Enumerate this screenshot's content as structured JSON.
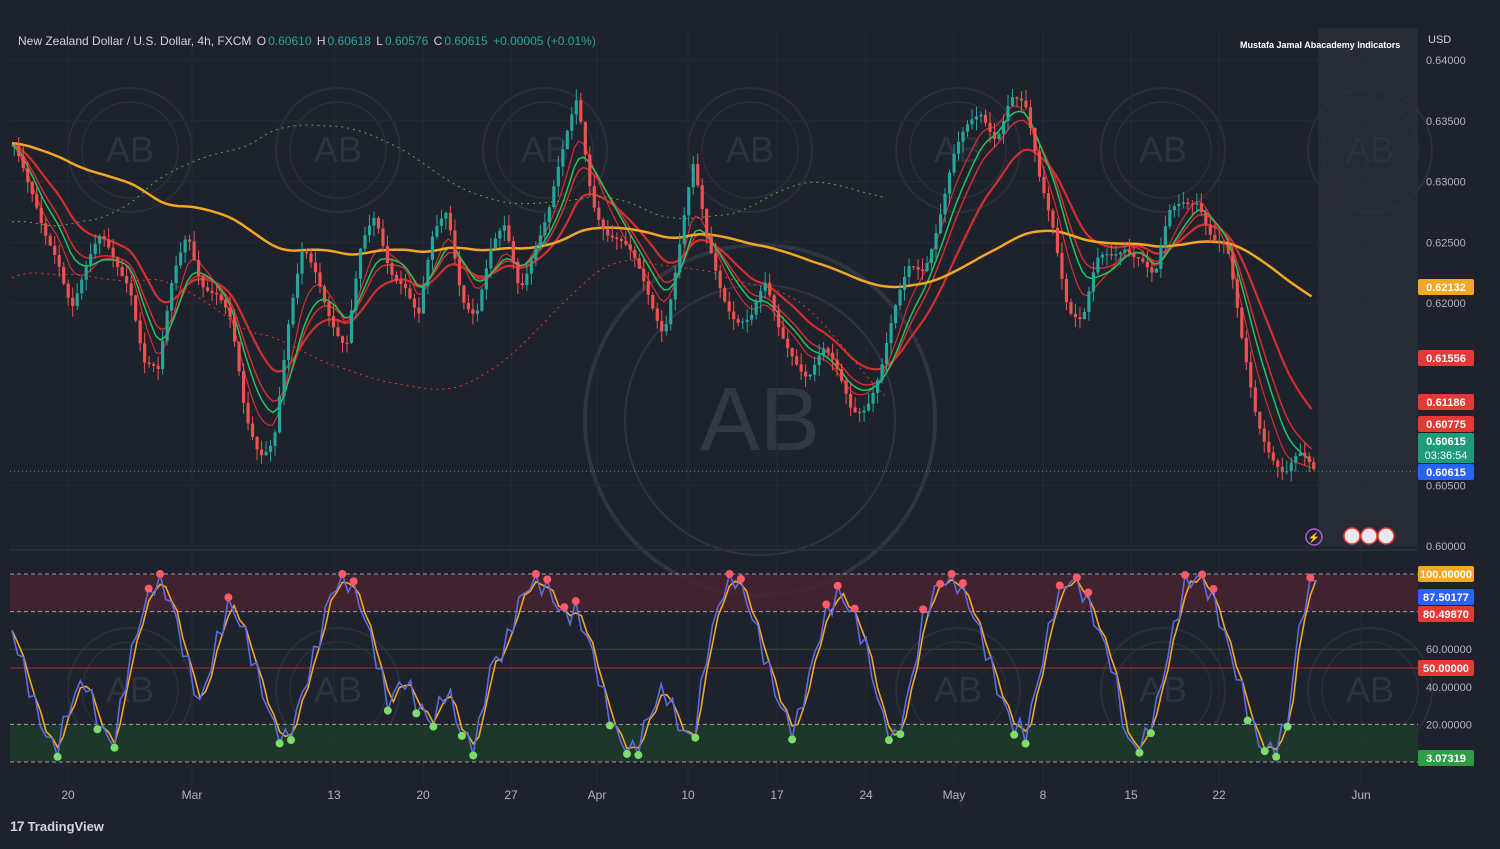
{
  "header": {
    "symbol": "New Zealand Dollar / U.S. Dollar, 4h, FXCM",
    "o_label": "O",
    "o_value": "0.60610",
    "h_label": "H",
    "h_value": "0.60618",
    "l_label": "L",
    "l_value": "0.60576",
    "c_label": "C",
    "c_value": "0.60615",
    "change": "+0.00005 (+0.01%)"
  },
  "indicator_title": "Mustafa Jamal Abacademy Indicators",
  "currency": "USD",
  "brand": {
    "logo": "17",
    "name": "TradingView"
  },
  "watermark_text": "AB",
  "colors": {
    "background": "#1e222d",
    "up": "#26a69a",
    "down": "#ef5350",
    "ema_slow": "#f5a623",
    "ema_red": "#d32f2f",
    "ema_green": "#22c55e",
    "stoch_k": "#5b6ee1",
    "stoch_d": "#f5a623"
  },
  "chart_data": [
    {
      "type": "candlestick",
      "title": "New Zealand Dollar / U.S. Dollar, 4h, FXCM",
      "ylabel": "USD",
      "ylim": [
        0.6,
        0.6405
      ],
      "y_ticks": [
        "0.64000",
        "0.63500",
        "0.63000",
        "0.62500",
        "0.62000",
        "0.60500",
        "0.60000"
      ],
      "x_ticks": [
        "20",
        "Mar",
        "13",
        "20",
        "27",
        "Apr",
        "10",
        "17",
        "24",
        "May",
        "8",
        "15",
        "22",
        "Jun"
      ],
      "close_path": [
        0.633,
        0.6285,
        0.6255,
        0.6245,
        0.6205,
        0.6225,
        0.6245,
        0.6235,
        0.6225,
        0.6155,
        0.6135,
        0.6215,
        0.6265,
        0.6225,
        0.6205,
        0.6175,
        0.6105,
        0.6085,
        0.6095,
        0.6175,
        0.6235,
        0.6225,
        0.6195,
        0.6165,
        0.6235,
        0.6265,
        0.6235,
        0.6225,
        0.6185,
        0.6245,
        0.6275,
        0.6215,
        0.6195,
        0.6235,
        0.6255,
        0.6215,
        0.6255,
        0.6275,
        0.6315,
        0.6365,
        0.6295,
        0.6265,
        0.6245,
        0.6225,
        0.6205,
        0.6185,
        0.6245,
        0.6305,
        0.6245,
        0.6215,
        0.6195,
        0.6185,
        0.6205,
        0.6175,
        0.6165,
        0.6145,
        0.6155,
        0.6135,
        0.6115,
        0.6125,
        0.6145,
        0.6185,
        0.6225,
        0.6235,
        0.6275,
        0.6315,
        0.6335,
        0.6355,
        0.6345,
        0.6375,
        0.6355,
        0.6295,
        0.6265,
        0.6205,
        0.6185,
        0.6225,
        0.6235,
        0.6255,
        0.6245,
        0.6215,
        0.6265,
        0.6285,
        0.6295,
        0.6255,
        0.6235,
        0.6165,
        0.6115,
        0.6085,
        0.6055,
        0.6065,
        0.60615
      ],
      "last_price": "0.60615",
      "countdown": "03:36:54",
      "price_labels": [
        {
          "text": "0.62132",
          "price": 0.62132,
          "color": "#f5a623"
        },
        {
          "text": "0.61556",
          "price": 0.61556,
          "color": "#e53935"
        },
        {
          "text": "0.61186",
          "price": 0.61186,
          "color": "#e53935"
        },
        {
          "text": "0.60775",
          "price": 0.60775,
          "color": "#e53935"
        },
        {
          "text": "0.60615",
          "price": 0.60615,
          "color": "#1e9c7a"
        },
        {
          "text": "0.60615",
          "price": 0.60615,
          "color": "#2962ff"
        }
      ]
    },
    {
      "type": "line",
      "title": "",
      "ylim": [
        0,
        100
      ],
      "y_ticks": [
        "60.00000",
        "40.00000",
        "20.00000"
      ],
      "levels": [
        100,
        80,
        50,
        20,
        0
      ],
      "series": [
        {
          "values": [
            70,
            45,
            20,
            5,
            30,
            45,
            20,
            8,
            50,
            80,
            98,
            85,
            55,
            30,
            60,
            85,
            70,
            45,
            20,
            10,
            35,
            60,
            90,
            99,
            85,
            60,
            30,
            45,
            30,
            20,
            40,
            15,
            8,
            50,
            60,
            85,
            98,
            92,
            78,
            80,
            60,
            30,
            10,
            5,
            25,
            40,
            20,
            10,
            60,
            90,
            99,
            80,
            55,
            30,
            15,
            45,
            75,
            90,
            80,
            60,
            25,
            10,
            40,
            80,
            95,
            99,
            85,
            65,
            40,
            20,
            15,
            50,
            85,
            98,
            90,
            70,
            50,
            10,
            8,
            30,
            65,
            95,
            99,
            85,
            60,
            35,
            10,
            5,
            20,
            80,
            100
          ]
        }
      ],
      "last_values": [
        {
          "text": "100.00000",
          "value": 100,
          "color": "#f5a623"
        },
        {
          "text": "87.50177",
          "value": 87.5,
          "color": "#2962ff"
        },
        {
          "text": "80.49870",
          "value": 80.5,
          "color": "#e53935"
        },
        {
          "text": "50.00000",
          "value": 50,
          "color": "#e53935"
        },
        {
          "text": "3.07319",
          "value": 3.07,
          "color": "#2e9e46"
        }
      ]
    }
  ]
}
